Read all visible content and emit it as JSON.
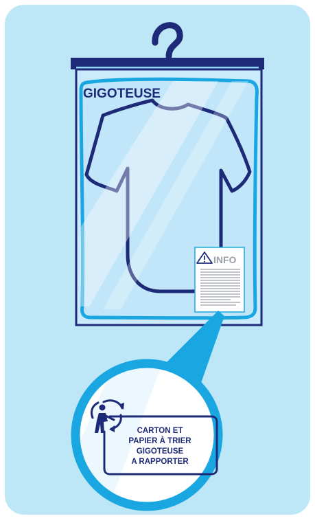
{
  "package": {
    "title": "GIGOTEUSE",
    "info_label": "INFO"
  },
  "recycling_label": {
    "lines": [
      "CARTON ET",
      "PAPIER À TRIER",
      "GIGOTEUSE",
      "A RAPPORTER"
    ]
  },
  "colors": {
    "background_panel": "#bde6f7",
    "navy": "#1d2a78",
    "hanger": "#1d2a78",
    "bag_fill": "#c6e9fa",
    "bag_outline": "#1aa7e1",
    "title": "#1d2a78",
    "magnifier_ring": "#1aa7e1",
    "info_label": "#9b9fa8"
  },
  "icons": [
    "hanger-icon",
    "garment-icon",
    "warning-triangle-icon",
    "recycle-person-icon"
  ]
}
